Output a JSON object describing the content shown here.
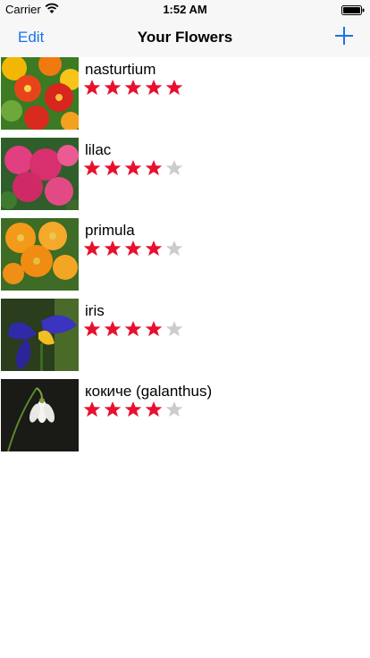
{
  "status_bar": {
    "carrier": "Carrier",
    "time": "1:52 AM"
  },
  "nav": {
    "left_button": "Edit",
    "title": "Your Flowers",
    "right_icon": "plus-icon"
  },
  "colors": {
    "accent": "#1a73e8",
    "star_filled": "#e8102e",
    "star_empty": "#cccccc"
  },
  "flowers": [
    {
      "name": "nasturtium",
      "rating": 5,
      "max_rating": 5
    },
    {
      "name": "lilac",
      "rating": 4,
      "max_rating": 5
    },
    {
      "name": "primula",
      "rating": 4,
      "max_rating": 5
    },
    {
      "name": "iris",
      "rating": 4,
      "max_rating": 5
    },
    {
      "name": "кокиче (galanthus)",
      "rating": 4,
      "max_rating": 5
    }
  ]
}
